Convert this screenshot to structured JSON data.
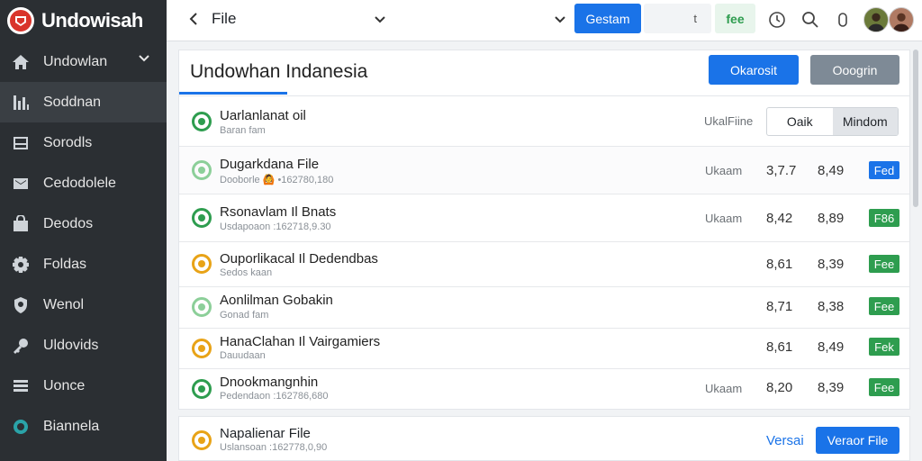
{
  "sidebar": {
    "brand": "Undowisah",
    "items": [
      {
        "label": "Undowlan",
        "icon": "home-icon"
      },
      {
        "label": "Soddnan",
        "icon": "chart-icon"
      },
      {
        "label": "Sorodls",
        "icon": "inbox-icon"
      },
      {
        "label": "Cedodolele",
        "icon": "mail-icon"
      },
      {
        "label": "Deodos",
        "icon": "bag-icon"
      },
      {
        "label": "Foldas",
        "icon": "gear-icon"
      },
      {
        "label": "Wenol",
        "icon": "shield-icon"
      },
      {
        "label": "Uldovids",
        "icon": "key-icon"
      },
      {
        "label": "Uonce",
        "icon": "list-icon"
      },
      {
        "label": "Biannela",
        "icon": "circle-icon"
      }
    ]
  },
  "topbar": {
    "file_label": "File",
    "primary_button": "Gestam",
    "segment_text": "t",
    "green_tag": "fee"
  },
  "panel": {
    "title": "Undowhan Indanesia",
    "btn_blue": "Okarosit",
    "btn_gray": "Ooogrin",
    "header_row": {
      "name": "Uarlanlanat oil",
      "sub": "Baran fam",
      "status": "UkalFiine",
      "toggle_left": "Oaik",
      "toggle_right": "Mindom"
    },
    "rows": [
      {
        "name": "Dugarkdana File",
        "sub": "Dooborle 🙆 •162780,180",
        "status": "Ukaam",
        "v1": "3,7.7",
        "v2": "8,49",
        "badge": "Fed",
        "badge_color": "blue",
        "dot": "light"
      },
      {
        "name": "Rsonavlam Il Bnats",
        "sub": "Usdapoaon :162718,9.30",
        "status": "Ukaam",
        "v1": "8,42",
        "v2": "8,89",
        "badge": "F86",
        "badge_color": "green",
        "dot": "green"
      },
      {
        "name": "Ouporlikacal Il Dedendbas",
        "sub": "Sedos kaan",
        "status": "",
        "v1": "8,61",
        "v2": "8,39",
        "badge": "Fee",
        "badge_color": "green",
        "dot": "orange"
      },
      {
        "name": "Aonlilman Gobakin",
        "sub": "Gonad fam",
        "status": "",
        "v1": "8,71",
        "v2": "8,38",
        "badge": "Fee",
        "badge_color": "green",
        "dot": "light"
      },
      {
        "name": "HanaClahan Il Vairgamiers",
        "sub": "Dauudaan",
        "status": "",
        "v1": "8,61",
        "v2": "8,49",
        "badge": "Fek",
        "badge_color": "green",
        "dot": "orange"
      },
      {
        "name": "Dnookmangnhin",
        "sub": "Pedendaon :162786,680",
        "status": "Ukaam",
        "v1": "8,20",
        "v2": "8,39",
        "badge": "Fee",
        "badge_color": "green",
        "dot": "green"
      }
    ]
  },
  "footer": {
    "name": "Napalienar File",
    "sub": "Uslansoan :162778,0,90",
    "link": "Versai",
    "button": "Veraor File"
  }
}
